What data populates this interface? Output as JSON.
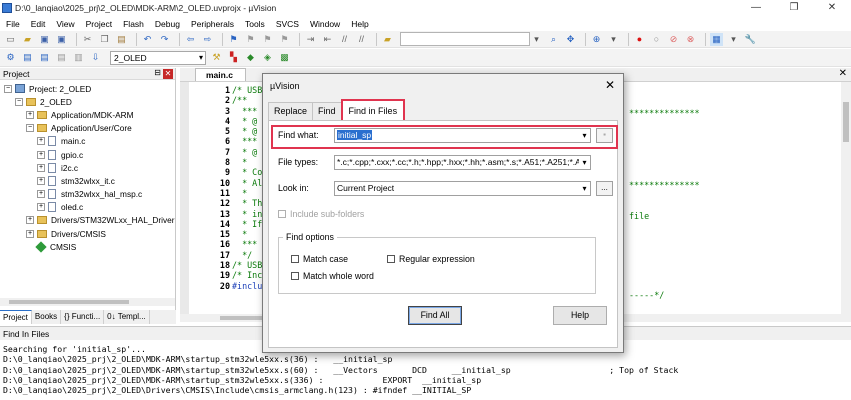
{
  "window": {
    "title": "D:\\0_lanqiao\\2025_prj\\2_OLED\\MDK-ARM\\2_OLED.uvprojx - µVision",
    "controls": [
      "—",
      "❐",
      "✕"
    ]
  },
  "menu": [
    "File",
    "Edit",
    "View",
    "Project",
    "Flash",
    "Debug",
    "Peripherals",
    "Tools",
    "SVCS",
    "Window",
    "Help"
  ],
  "toolbar": {
    "target": "2_OLED"
  },
  "project_panel": {
    "title": "Project",
    "tree": [
      {
        "label": "Project: 2_OLED",
        "depth": 0,
        "exp": "−",
        "icon": "root"
      },
      {
        "label": "2_OLED",
        "depth": 1,
        "exp": "−",
        "icon": "folder"
      },
      {
        "label": "Application/MDK-ARM",
        "depth": 2,
        "exp": "+",
        "icon": "folder"
      },
      {
        "label": "Application/User/Core",
        "depth": 2,
        "exp": "−",
        "icon": "folder"
      },
      {
        "label": "main.c",
        "depth": 3,
        "exp": "+",
        "icon": "file"
      },
      {
        "label": "gpio.c",
        "depth": 3,
        "exp": "+",
        "icon": "file"
      },
      {
        "label": "i2c.c",
        "depth": 3,
        "exp": "+",
        "icon": "file"
      },
      {
        "label": "stm32wlxx_it.c",
        "depth": 3,
        "exp": "+",
        "icon": "file"
      },
      {
        "label": "stm32wlxx_hal_msp.c",
        "depth": 3,
        "exp": "+",
        "icon": "file"
      },
      {
        "label": "oled.c",
        "depth": 3,
        "exp": "+",
        "icon": "file"
      },
      {
        "label": "Drivers/STM32WLxx_HAL_Driver",
        "depth": 2,
        "exp": "+",
        "icon": "folder"
      },
      {
        "label": "Drivers/CMSIS",
        "depth": 2,
        "exp": "+",
        "icon": "folder"
      },
      {
        "label": "CMSIS",
        "depth": 2,
        "exp": "",
        "icon": "gem"
      }
    ],
    "tabs": [
      "Project",
      "Books",
      "{} Functi...",
      "0↓ Templ..."
    ]
  },
  "editor": {
    "tabs": [
      "main.c"
    ],
    "line_numbers": [
      "1",
      "2",
      "3",
      "4",
      "5",
      "6",
      "7",
      "8",
      "9",
      "10",
      "11",
      "12",
      "13",
      "14",
      "15",
      "16",
      "17",
      "18",
      "19",
      "20"
    ],
    "code_lines": [
      "/* USB",
      "/**",
      "  ***",
      "  * @",
      "  * @",
      "  ***",
      "  * @",
      "  *",
      "  * Co",
      "  * Al",
      "  *",
      "  * Th",
      "  * in",
      "  * If",
      "  *",
      "  ***",
      "  */",
      "/* USB",
      "/* Inc",
      "#inclu"
    ],
    "right_fragments": {
      "stars_a": "**************",
      "stars_b": "**************",
      "file_word": "file",
      "end_comment": "-----*/"
    }
  },
  "output_panel": {
    "title": "Find In Files",
    "lines": [
      "Searching for 'initial_sp'...",
      "D:\\0_lanqiao\\2025_prj\\2_OLED\\MDK-ARM\\startup_stm32wle5xx.s(36) :   __initial_sp",
      "D:\\0_lanqiao\\2025_prj\\2_OLED\\MDK-ARM\\startup_stm32wle5xx.s(60) :   __Vectors       DCD     __initial_sp                    ; Top of Stack",
      "D:\\0_lanqiao\\2025_prj\\2_OLED\\MDK-ARM\\startup_stm32wle5xx.s(336) :            EXPORT  __initial_sp",
      "D:\\0_lanqiao\\2025_prj\\2_OLED\\Drivers\\CMSIS\\Include\\cmsis_armclang.h(123) : #ifndef __INITIAL_SP"
    ]
  },
  "dialog": {
    "title": "µVision",
    "tabs": [
      "Replace",
      "Find",
      "Find in Files"
    ],
    "active_tab": "Find in Files",
    "find_what_label": "Find what:",
    "find_what_value": "initial_sp",
    "file_types_label": "File types:",
    "file_types_value": "*.c;*.cpp;*.cxx;*.cc;*.h;*.hpp;*.hxx;*.hh;*.asm;*.s;*.A51;*.A251;*.A16",
    "look_in_label": "Look in:",
    "look_in_value": "Current Project",
    "browse_label": "...",
    "include_subfolders_label": "Include sub-folders",
    "find_options_label": "Find options",
    "match_case_label": "Match case",
    "match_whole_word_label": "Match whole word",
    "regex_label": "Regular expression",
    "find_all_label": "Find All",
    "help_label": "Help",
    "highlight_color": "#e0344f"
  }
}
